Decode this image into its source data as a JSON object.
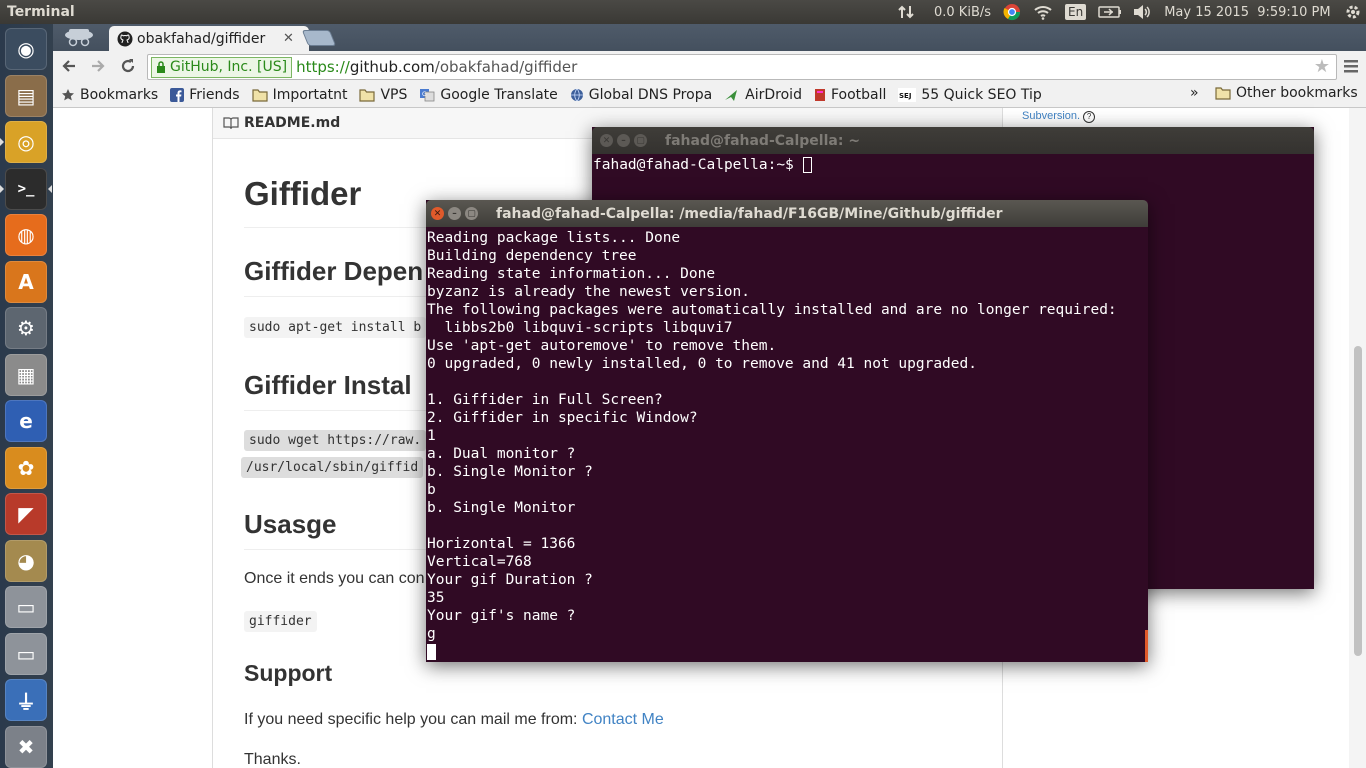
{
  "top_panel": {
    "title": "Terminal",
    "net_speed": "0.0 KiB/s",
    "keyboard": "En",
    "datetime": "May 15 2015  9:59:10 PM"
  },
  "launcher": {
    "items": [
      {
        "name": "ubuntu-dash-icon",
        "color": "#3b4c5f"
      },
      {
        "name": "files-icon",
        "color": "#8a6d4a"
      },
      {
        "name": "chrome-icon",
        "color": "#d9a227"
      },
      {
        "name": "terminal-icon",
        "color": "#2c2c2c"
      },
      {
        "name": "firefox-icon",
        "color": "#e66c1c"
      },
      {
        "name": "software-center-icon",
        "color": "#d9761c"
      },
      {
        "name": "system-settings-icon",
        "color": "#5d6670"
      },
      {
        "name": "calculator-icon",
        "color": "#8b8b8b"
      },
      {
        "name": "internet-explorer-icon",
        "color": "#2f5fb3"
      },
      {
        "name": "app-orange-icon",
        "color": "#d98c1e"
      },
      {
        "name": "app-red-icon",
        "color": "#b83a2a"
      },
      {
        "name": "gimp-icon",
        "color": "#a48a4f"
      },
      {
        "name": "drive-icon",
        "color": "#8e939a"
      },
      {
        "name": "drive-2-icon",
        "color": "#8e939a"
      },
      {
        "name": "usb-icon",
        "color": "#3a6fb8"
      },
      {
        "name": "trash-icon",
        "color": "#7c8189"
      }
    ]
  },
  "browser": {
    "tab_title": "obakfahad/giffider",
    "ev_label": "GitHub, Inc. [US]",
    "url_scheme": "https://",
    "url_host": "github.com",
    "url_path": "/obakfahad/giffider",
    "bookmarks": [
      {
        "label": "Bookmarks",
        "icon": "star-icon"
      },
      {
        "label": "Friends",
        "icon": "facebook-icon"
      },
      {
        "label": "Importatnt",
        "icon": "folder-icon"
      },
      {
        "label": "VPS",
        "icon": "folder-icon"
      },
      {
        "label": "Google Translate",
        "icon": "translate-icon"
      },
      {
        "label": "Global DNS Propa",
        "icon": "globe-icon"
      },
      {
        "label": "AirDroid",
        "icon": "airdroid-icon"
      },
      {
        "label": "Football",
        "icon": "book-icon"
      },
      {
        "label": "55 Quick SEO Tip",
        "icon": "sej-icon"
      }
    ],
    "overflow": "»",
    "other_bookmarks": "Other bookmarks"
  },
  "page": {
    "readme_header": "README.md",
    "title": "Giffider",
    "h_dependency": "Giffider Depen",
    "code_dependency": "sudo apt-get install b",
    "h_install": "Giffider Instal",
    "code_install_1": "sudo wget https://raw.",
    "code_install_2": "/usr/local/sbin/giffid",
    "h_usage": "Usasge",
    "usage_text": "Once it ends you can con",
    "code_usage": "giffider",
    "h_support": "Support",
    "support_text": "If you need specific help you can mail me from: ",
    "support_link": "Contact Me",
    "thanks": "Thanks.",
    "sidebar_link": "Subversion."
  },
  "terminal_back": {
    "title": "fahad@fahad-Calpella: ~",
    "prompt": "fahad@fahad-Calpella:~$ "
  },
  "terminal_front": {
    "title": "fahad@fahad-Calpella: /media/fahad/F16GB/Mine/Github/giffider",
    "lines": [
      "Reading package lists... Done",
      "Building dependency tree",
      "Reading state information... Done",
      "byzanz is already the newest version.",
      "The following packages were automatically installed and are no longer required:",
      "  libbs2b0 libquvi-scripts libquvi7",
      "Use 'apt-get autoremove' to remove them.",
      "0 upgraded, 0 newly installed, 0 to remove and 41 not upgraded.",
      "",
      "1. Giffider in Full Screen?",
      "2. Giffider in specific Window?",
      "1",
      "a. Dual monitor ?",
      "b. Single Monitor ?",
      "b",
      "b. Single Monitor",
      "",
      "Horizontal = 1366",
      "Vertical=768",
      "Your gif Duration ?",
      "35",
      "Your gif's name ?",
      "g"
    ]
  },
  "colors": {
    "terminal_bg": "#300a24",
    "github_link": "#4183c4",
    "ev_green": "#2a8a1a"
  }
}
